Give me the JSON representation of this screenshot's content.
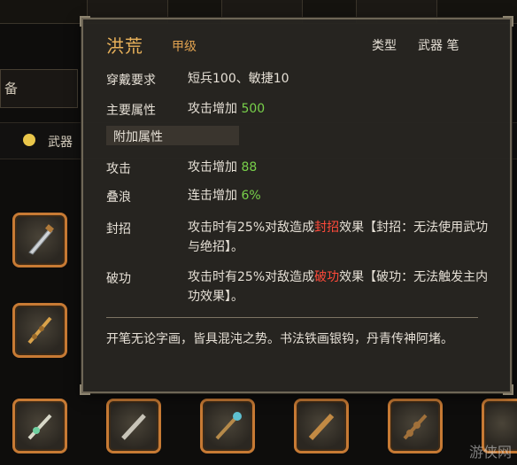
{
  "background": {
    "left_tab_label": "备",
    "filter_label": "武器",
    "filter_dot_color": "#e9c64a",
    "slot_icons": [
      "sword-icon",
      "spear-icon",
      "dagger-icon",
      "brush-icon",
      "staff-icon",
      "club-icon",
      "fan-icon",
      "whip-icon"
    ]
  },
  "tooltip": {
    "name": "洪荒",
    "grade": "甲级",
    "type_label": "类型",
    "type_value": "武器 笔",
    "requirements": {
      "label": "穿戴要求",
      "value": "短兵100、敏捷10"
    },
    "main_attr": {
      "label": "主要属性",
      "text": "攻击增加",
      "num": "500"
    },
    "extra_section": "附加属性",
    "extras": [
      {
        "label": "攻击",
        "text": "攻击增加",
        "num": "88"
      },
      {
        "label": "叠浪",
        "text": "连击增加",
        "num": "6%"
      }
    ],
    "effects": [
      {
        "label": "封招",
        "pre": "攻击时有25%对敌造成",
        "hl": "封招",
        "post": "效果【封招：无法使用武功与绝招】。"
      },
      {
        "label": "破功",
        "pre": "攻击时有25%对敌造成",
        "hl": "破功",
        "post": "效果【破功：无法触发主内功效果】。"
      }
    ],
    "flavor": "开笔无论字画，皆具混沌之势。书法铁画银钩，丹青传神阿堵。"
  },
  "watermark": "游侠网",
  "colors": {
    "name": "#e8b15a",
    "number": "#78d04a",
    "highlight": "#ff4a3a",
    "slot_border": "#c77a34"
  }
}
